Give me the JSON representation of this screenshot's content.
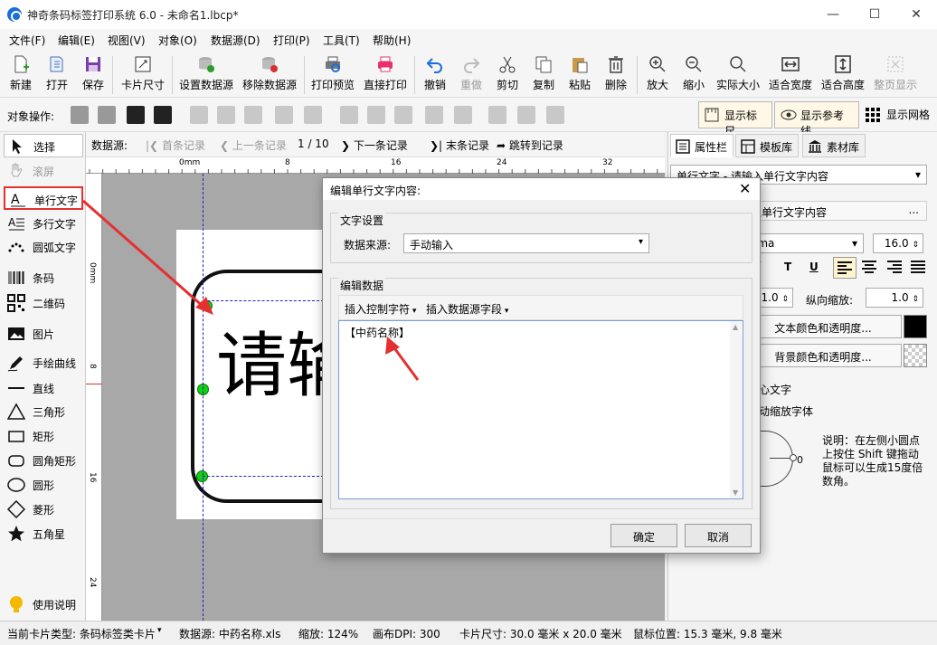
{
  "window": {
    "title": "神奇条码标签打印系统 6.0 - 未命名1.lbcp*"
  },
  "menu": [
    "文件(F)",
    "编辑(E)",
    "视图(V)",
    "对象(O)",
    "数据源(D)",
    "打印(P)",
    "工具(T)",
    "帮助(H)"
  ],
  "toolbar": {
    "new": "新建",
    "open": "打开",
    "save": "保存",
    "card_size": "卡片尺寸",
    "set_ds": "设置数据源",
    "remove_ds": "移除数据源",
    "print_preview": "打印预览",
    "direct_print": "直接打印",
    "undo": "撤销",
    "redo": "重做",
    "cut": "剪切",
    "copy": "复制",
    "paste": "粘贴",
    "delete": "删除",
    "zoom_in": "放大",
    "zoom_out": "缩小",
    "actual_size": "实际大小",
    "fit_width": "适合宽度",
    "fit_height": "适合高度",
    "fit_page": "整页显示"
  },
  "objbar": {
    "label": "对象操作:",
    "show_ruler": "显示标尺",
    "show_guides": "显示参考线",
    "show_grid": "显示网格"
  },
  "left_tools": [
    "选择",
    "滚屏",
    "单行文字",
    "多行文字",
    "圆弧文字",
    "条码",
    "二维码",
    "图片",
    "手绘曲线",
    "直线",
    "三角形",
    "矩形",
    "圆角矩形",
    "圆形",
    "菱形",
    "五角星",
    "使用说明"
  ],
  "navbar": {
    "label": "数据源:",
    "first": "首条记录",
    "prev": "上一条记录",
    "counter": "1 / 10",
    "next": "下一条记录",
    "last": "末条记录",
    "goto": "跳转到记录"
  },
  "ruler": {
    "h_ticks": [
      "0mm",
      "8",
      "16",
      "24",
      "32"
    ],
    "v_ticks": [
      "0mm",
      "8",
      "16",
      "24"
    ]
  },
  "card": {
    "text": "请输"
  },
  "right_panel": {
    "tabs": [
      "属性栏",
      "模板库",
      "素材库"
    ],
    "object_combo": "单行文字 - 请输入单行文字内容",
    "content": "入单行文字内容",
    "more": "...",
    "font": "oma",
    "font_size": "16.0",
    "spin1": "1.0",
    "vscale_label": "纵向缩放:",
    "vscale": "1.0",
    "text_color_btn": "文本颜色和透明度...",
    "bg_color_btn": "背景颜色和透明度...",
    "center_text": "心文字",
    "auto_shrink": "动缩放字体",
    "rotation": "0",
    "note": "说明：在左侧小圆点上按住 Shift 键拖动鼠标可以生成15度倍数角。"
  },
  "dialog": {
    "title": "编辑单行文字内容:",
    "group1": "文字设置",
    "ds_label": "数据来源:",
    "ds_value": "手动输入",
    "group2": "编辑数据",
    "insert_ctrl": "插入控制字符",
    "insert_field": "插入数据源字段",
    "content": "【中药名称】",
    "ok": "确定",
    "cancel": "取消"
  },
  "status": {
    "card_type": "当前卡片类型: 条码标签类卡片",
    "datasource": "数据源: 中药名称.xls",
    "zoom": "缩放: 124%",
    "dpi": "画布DPI: 300",
    "card_size": "卡片尺寸: 30.0 毫米 x 20.0 毫米",
    "mouse": "鼠标位置: 15.3 毫米, 9.8 毫米"
  },
  "colors": {
    "accent": "#1a6ed8",
    "highlight": "#e53030"
  }
}
